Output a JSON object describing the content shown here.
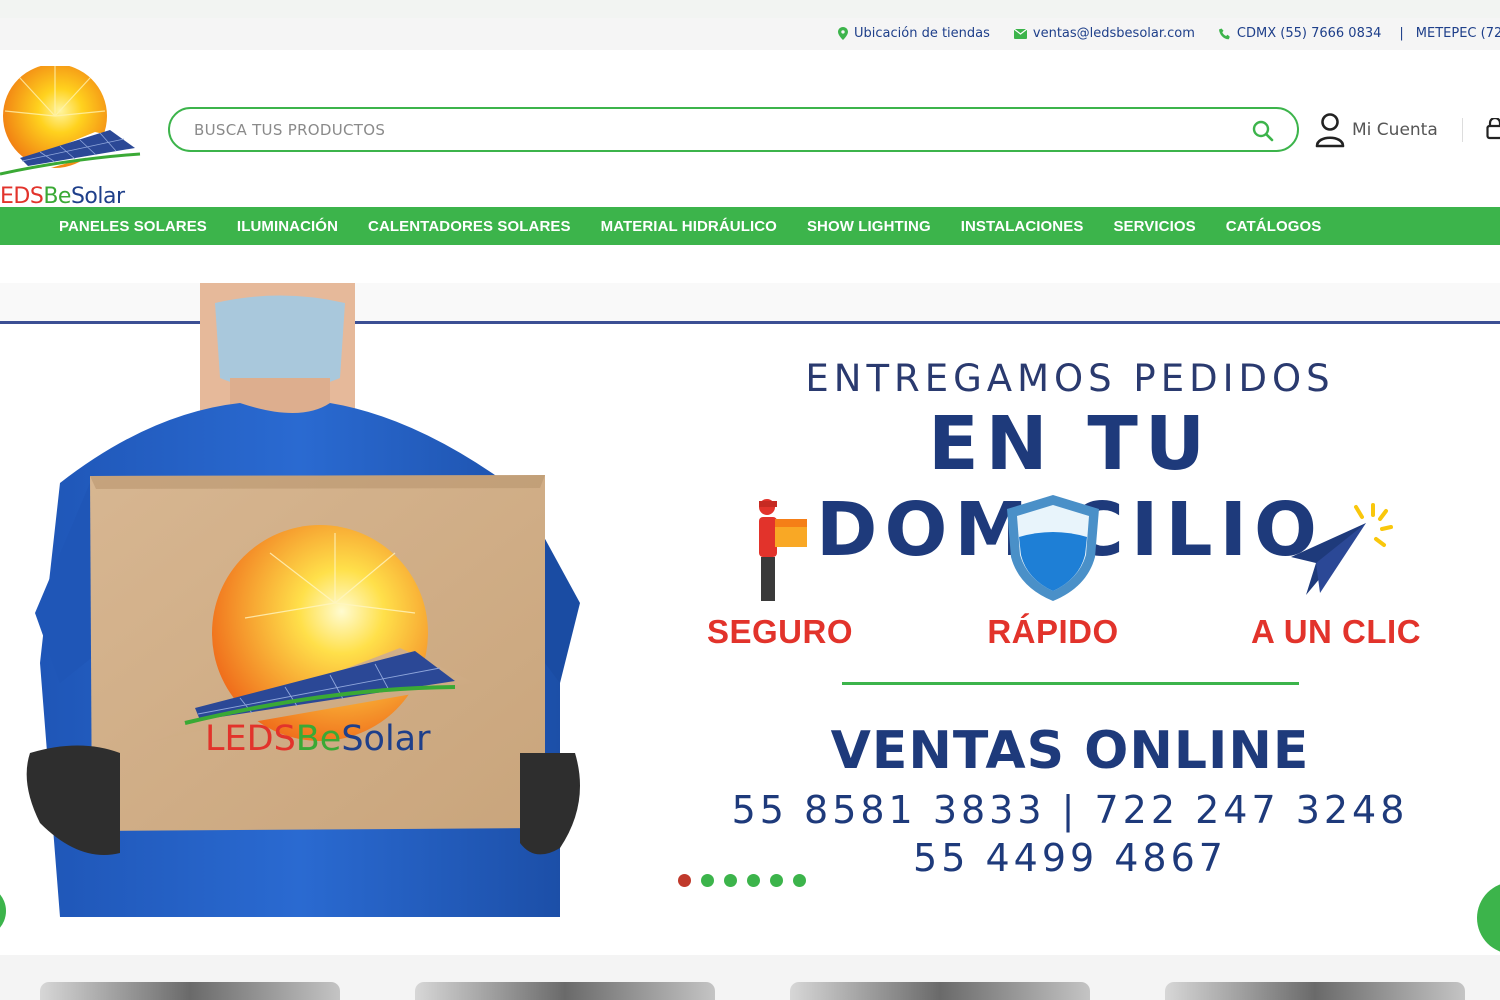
{
  "topbar": {
    "items": [
      {
        "icon": "map-pin-icon",
        "label": "Ubicación de tiendas"
      },
      {
        "icon": "envelope-icon",
        "label": "ventas@ledsbesolar.com"
      },
      {
        "icon": "phone-icon",
        "label": "CDMX (55) 7666 0834"
      }
    ],
    "separator": "|",
    "extra": "METEPEC (72"
  },
  "header": {
    "logo_text": {
      "part1": "EDS",
      "part2": "Be",
      "part3": "Solar"
    },
    "search_placeholder": "BUSCA TUS PRODUCTOS",
    "account_label": "Mi Cuenta"
  },
  "nav": {
    "items": [
      "PANELES SOLARES",
      "ILUMINACIÓN",
      "CALENTADORES SOLARES",
      "MATERIAL HIDRÁULICO",
      "SHOW LIGHTING",
      "INSTALACIONES",
      "SERVICIOS",
      "CATÁLOGOS"
    ]
  },
  "hero": {
    "title_small": "ENTREGAMOS PEDIDOS",
    "title_big": "EN TU DOMICILIO",
    "features": [
      "SEGURO",
      "RÁPIDO",
      "A UN CLIC"
    ],
    "ventas_title": "VENTAS ONLINE",
    "phones_line1": "55 8581 3833 | 722 247 3248",
    "phones_line2": "55 4499 4867",
    "box_logo": {
      "part1": "LEDS",
      "part2": "Be",
      "part3": "Solar"
    },
    "slides_count": 6,
    "active_slide": 1
  },
  "colors": {
    "accent_green": "#3cb44b",
    "brand_blue": "#1e3a7b",
    "brand_red": "#e2332b"
  }
}
